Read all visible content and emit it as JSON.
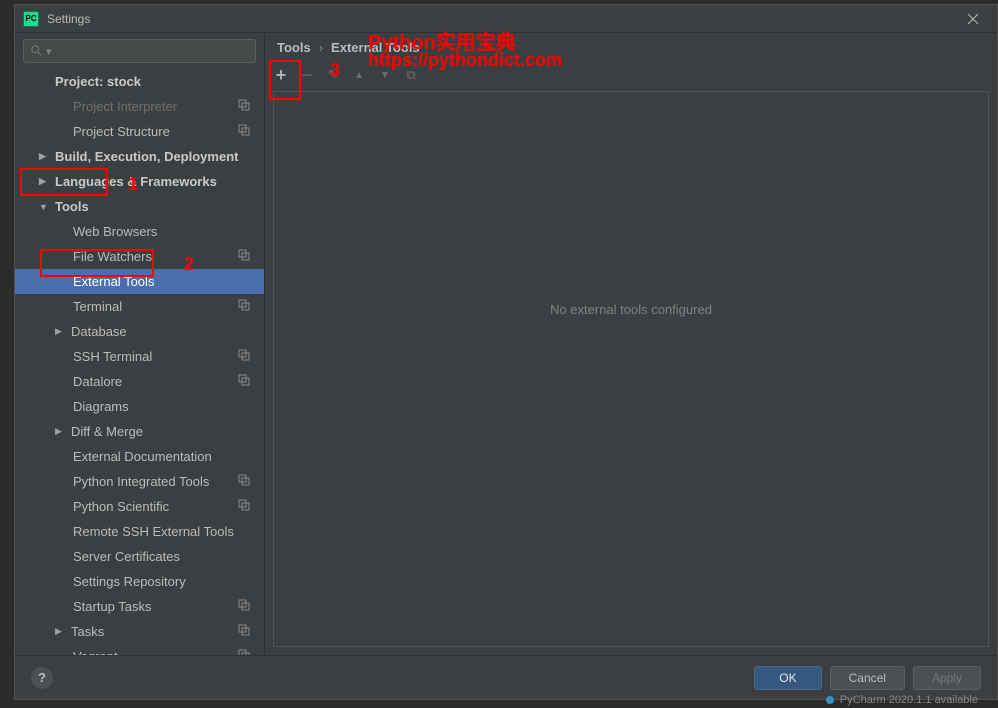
{
  "window": {
    "title": "Settings",
    "app_icon_text": "PC"
  },
  "search": {
    "placeholder": ""
  },
  "sidebar": {
    "items": [
      {
        "label": "Project: stock",
        "level": 1,
        "bold": true,
        "arrow": "",
        "right": ""
      },
      {
        "label": "Project Interpreter",
        "level": 2,
        "bold": false,
        "arrow": "",
        "right": "⮌",
        "dim": true
      },
      {
        "label": "Project Structure",
        "level": 2,
        "bold": false,
        "arrow": "",
        "right": "⮌"
      },
      {
        "label": "Build, Execution, Deployment",
        "level": 1,
        "bold": true,
        "arrow": "▶",
        "right": ""
      },
      {
        "label": "Languages & Frameworks",
        "level": 1,
        "bold": true,
        "arrow": "▶",
        "right": ""
      },
      {
        "label": "Tools",
        "level": 1,
        "bold": true,
        "arrow": "▼",
        "right": ""
      },
      {
        "label": "Web Browsers",
        "level": 2,
        "bold": false,
        "arrow": "",
        "right": ""
      },
      {
        "label": "File Watchers",
        "level": 2,
        "bold": false,
        "arrow": "",
        "right": "⮌"
      },
      {
        "label": "External Tools",
        "level": 2,
        "bold": false,
        "arrow": "",
        "right": "",
        "selected": true
      },
      {
        "label": "Terminal",
        "level": 2,
        "bold": false,
        "arrow": "",
        "right": "⮌"
      },
      {
        "label": "Database",
        "level": 2,
        "bold": false,
        "arrow": "▶",
        "right": ""
      },
      {
        "label": "SSH Terminal",
        "level": 2,
        "bold": false,
        "arrow": "",
        "right": "⮌"
      },
      {
        "label": "Datalore",
        "level": 2,
        "bold": false,
        "arrow": "",
        "right": "⮌"
      },
      {
        "label": "Diagrams",
        "level": 2,
        "bold": false,
        "arrow": "",
        "right": ""
      },
      {
        "label": "Diff & Merge",
        "level": 2,
        "bold": false,
        "arrow": "▶",
        "right": ""
      },
      {
        "label": "External Documentation",
        "level": 2,
        "bold": false,
        "arrow": "",
        "right": ""
      },
      {
        "label": "Python Integrated Tools",
        "level": 2,
        "bold": false,
        "arrow": "",
        "right": "⮌"
      },
      {
        "label": "Python Scientific",
        "level": 2,
        "bold": false,
        "arrow": "",
        "right": "⮌"
      },
      {
        "label": "Remote SSH External Tools",
        "level": 2,
        "bold": false,
        "arrow": "",
        "right": ""
      },
      {
        "label": "Server Certificates",
        "level": 2,
        "bold": false,
        "arrow": "",
        "right": ""
      },
      {
        "label": "Settings Repository",
        "level": 2,
        "bold": false,
        "arrow": "",
        "right": ""
      },
      {
        "label": "Startup Tasks",
        "level": 2,
        "bold": false,
        "arrow": "",
        "right": "⮌"
      },
      {
        "label": "Tasks",
        "level": 2,
        "bold": false,
        "arrow": "▶",
        "right": "⮌"
      },
      {
        "label": "Vagrant",
        "level": 2,
        "bold": false,
        "arrow": "",
        "right": "⮌"
      }
    ]
  },
  "breadcrumb": {
    "part1": "Tools",
    "sep": "›",
    "part2": "External Tools"
  },
  "toolbar": {
    "add": "+",
    "remove": "−",
    "edit": "✎",
    "up": "▲",
    "down": "▼",
    "copy": "⧉"
  },
  "main": {
    "empty_text": "No external tools configured"
  },
  "footer": {
    "help": "?",
    "ok": "OK",
    "cancel": "Cancel",
    "apply": "Apply"
  },
  "annotations": {
    "n1": "1",
    "n2": "2",
    "n3": "3",
    "title_cn": "Python实用宝典",
    "url": "https://pythondict.com"
  },
  "statusbar": {
    "text": "PyCharm 2020.1.1 available"
  }
}
